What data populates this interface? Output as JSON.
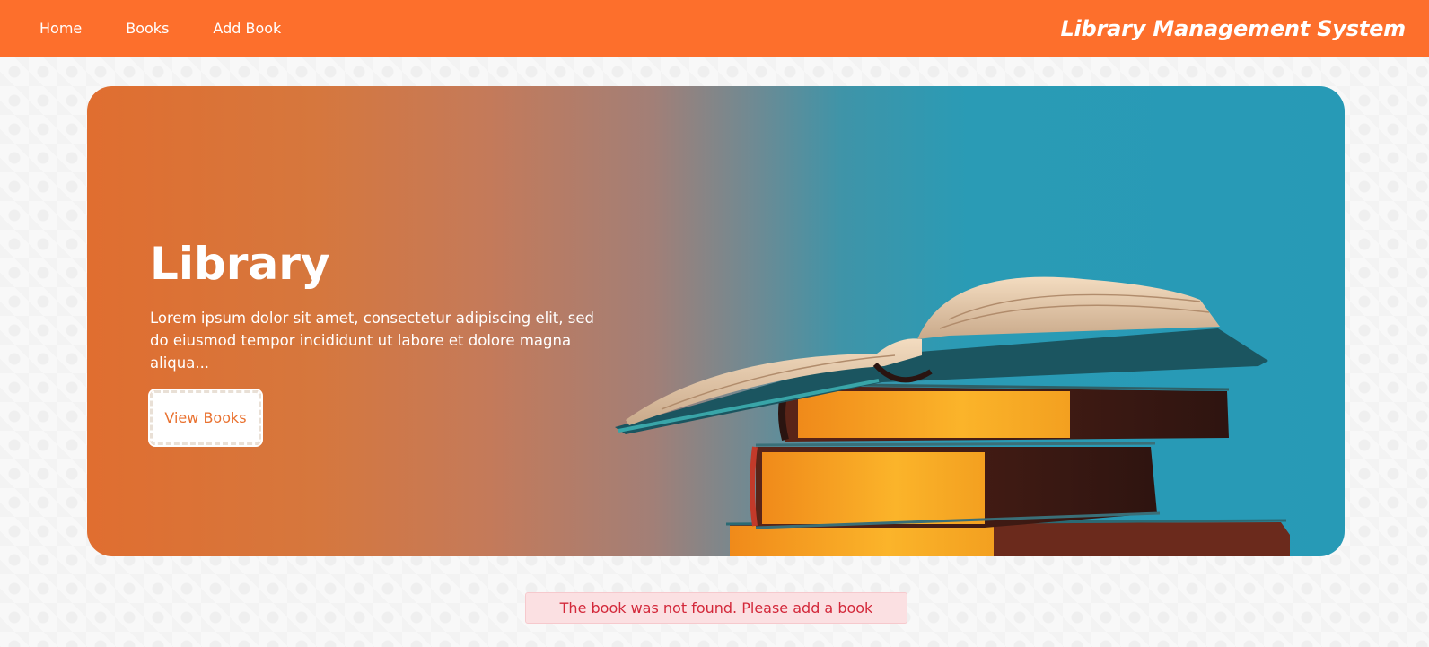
{
  "nav": {
    "items": [
      {
        "label": "Home"
      },
      {
        "label": "Books"
      },
      {
        "label": "Add Book"
      }
    ],
    "brand": "Library Management System"
  },
  "hero": {
    "title": "Library",
    "description": "Lorem ipsum dolor sit amet, consectetur adipiscing elit, sed do eiusmod tempor incididunt ut labore et dolore magna aliqua...",
    "button_label": "View Books"
  },
  "alert": {
    "message": "The book was not found. Please add a book"
  },
  "colors": {
    "header": "#fd6f2c",
    "hero_left": "#e06e30",
    "hero_right": "#279ab6",
    "alert_text": "#d3283a",
    "alert_bg": "#fbe0e2"
  }
}
